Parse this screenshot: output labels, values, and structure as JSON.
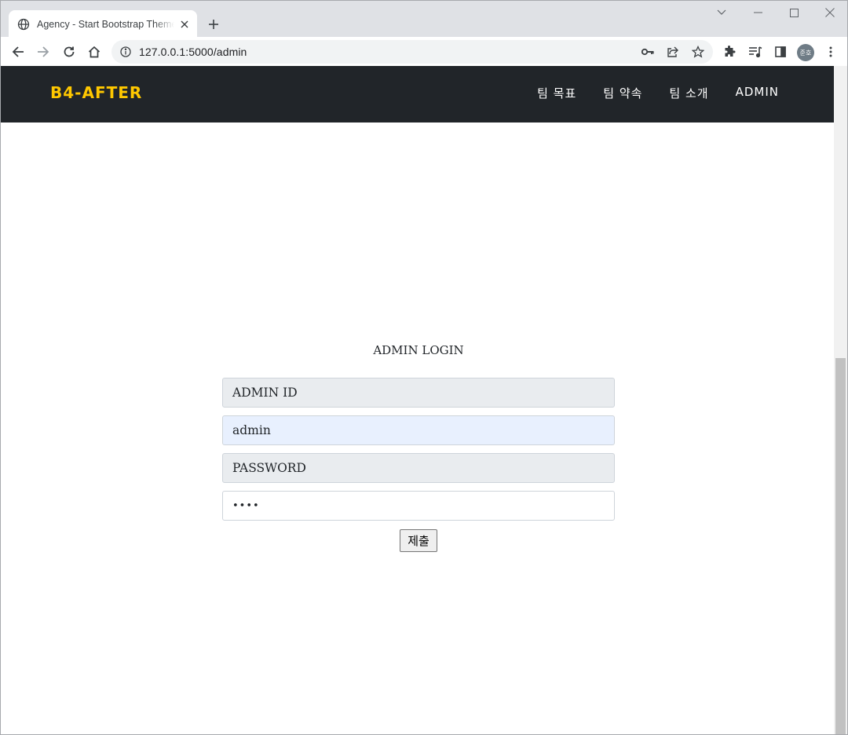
{
  "browser": {
    "tab_title": "Agency - Start Bootstrap Theme",
    "url": "127.0.0.1:5000/admin",
    "profile_initials": "준호"
  },
  "navbar": {
    "brand": "B4-AFTER",
    "links": [
      "팀 목표",
      "팀 약속",
      "팀 소개",
      "ADMIN"
    ]
  },
  "login": {
    "title": "ADMIN LOGIN",
    "id_label": "ADMIN ID",
    "id_value": "admin",
    "password_label": "PASSWORD",
    "password_mask": "••••",
    "submit_label": "제출"
  },
  "colors": {
    "brand": "#ffc800",
    "navbar_bg": "#212529",
    "autofill_bg": "#e8f0fe"
  }
}
